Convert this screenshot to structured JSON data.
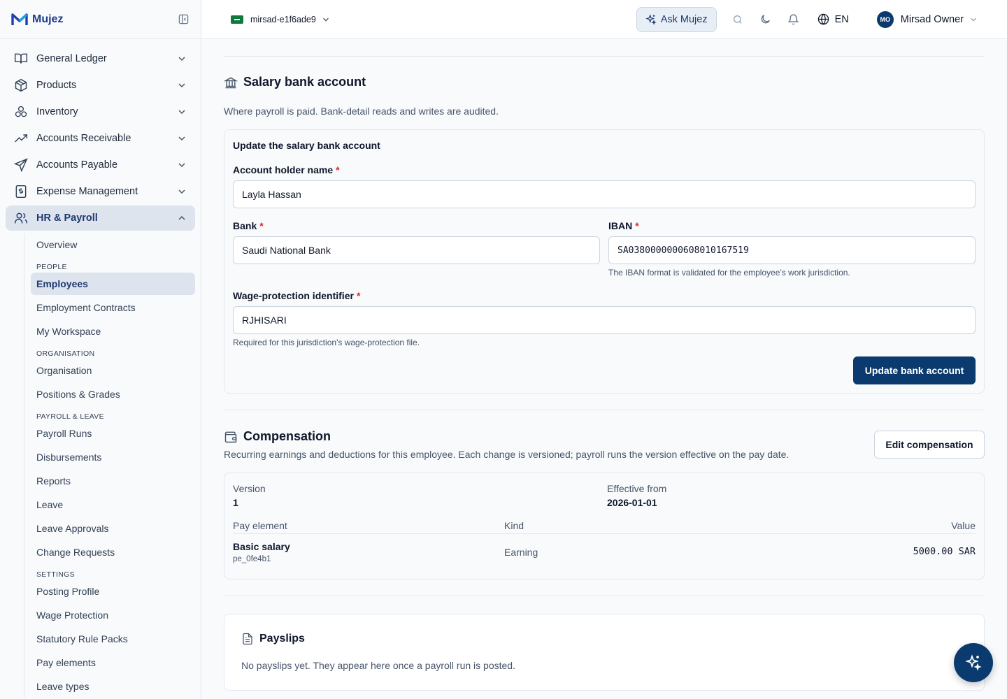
{
  "app": {
    "name": "Mujez"
  },
  "sidebar": {
    "items": [
      {
        "label": "General Ledger",
        "icon": "book-open-icon"
      },
      {
        "label": "Products",
        "icon": "package-icon"
      },
      {
        "label": "Inventory",
        "icon": "boxes-icon"
      },
      {
        "label": "Accounts Receivable",
        "icon": "trending-up-icon"
      },
      {
        "label": "Accounts Payable",
        "icon": "send-icon"
      },
      {
        "label": "Expense Management",
        "icon": "receipt-icon"
      },
      {
        "label": "HR & Payroll",
        "icon": "users-icon"
      }
    ],
    "hr_sub": {
      "overview": "Overview",
      "people_heading": "PEOPLE",
      "employees": "Employees",
      "employment_contracts": "Employment Contracts",
      "my_workspace": "My Workspace",
      "org_heading": "ORGANISATION",
      "organisation": "Organisation",
      "positions_grades": "Positions & Grades",
      "payroll_heading": "PAYROLL & LEAVE",
      "payroll_runs": "Payroll Runs",
      "disbursements": "Disbursements",
      "reports": "Reports",
      "leave": "Leave",
      "leave_approvals": "Leave Approvals",
      "change_requests": "Change Requests",
      "settings_heading": "SETTINGS",
      "posting_profile": "Posting Profile",
      "wage_protection": "Wage Protection",
      "statutory_rule_packs": "Statutory Rule Packs",
      "pay_elements": "Pay elements",
      "leave_types": "Leave types"
    }
  },
  "topbar": {
    "tenant": "mirsad-e1f6ade9",
    "ask": "Ask Mujez",
    "language": "EN",
    "user_initials": "MO",
    "user_name": "Mirsad Owner"
  },
  "bank": {
    "title": "Salary bank account",
    "description": "Where payroll is paid. Bank-detail reads and writes are audited.",
    "form_title": "Update the salary bank account",
    "holder_label": "Account holder name",
    "holder_value": "Layla Hassan",
    "bank_label": "Bank",
    "bank_value": "Saudi National Bank",
    "iban_label": "IBAN",
    "iban_value": "SA0380000000608010167519",
    "iban_hint": "The IBAN format is validated for the employee's work jurisdiction.",
    "wps_label": "Wage-protection identifier",
    "wps_value": "RJHISARI",
    "wps_hint": "Required for this jurisdiction's wage-protection file.",
    "required_mark": "*",
    "submit": "Update bank account"
  },
  "compensation": {
    "title": "Compensation",
    "description": "Recurring earnings and deductions for this employee. Each change is versioned; payroll runs the version effective on the pay date.",
    "edit_button": "Edit compensation",
    "version_label": "Version",
    "version_value": "1",
    "effective_label": "Effective from",
    "effective_value": "2026-01-01",
    "columns": {
      "element": "Pay element",
      "kind": "Kind",
      "value": "Value"
    },
    "rows": [
      {
        "name": "Basic salary",
        "id": "pe_0fe4b1",
        "kind": "Earning",
        "value": "5000.00",
        "currency": "SAR"
      }
    ]
  },
  "payslips": {
    "title": "Payslips",
    "empty": "No payslips yet. They appear here once a payroll run is posted."
  },
  "colors": {
    "primary": "#0b3b6e",
    "active_bg": "#dde4ee",
    "required": "#dc2626"
  }
}
